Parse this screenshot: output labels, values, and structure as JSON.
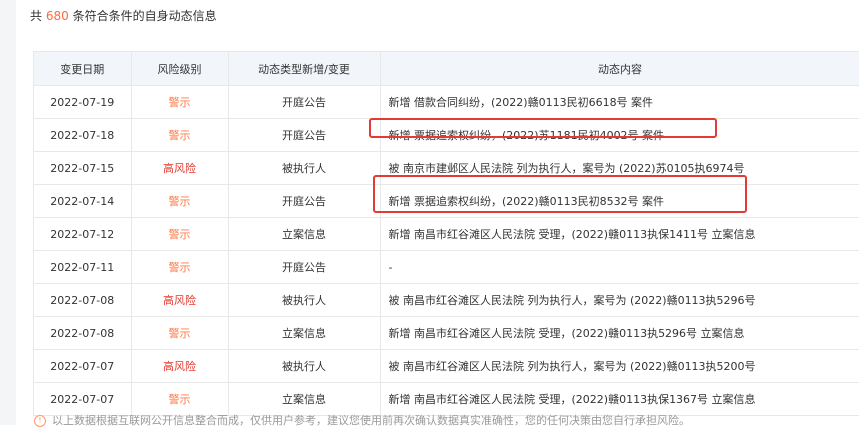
{
  "summary": {
    "prefix": "共",
    "count": "680",
    "suffix": "条符合条件的自身动态信息"
  },
  "table": {
    "headers": [
      "变更日期",
      "风险级别",
      "动态类型新增/变更",
      "动态内容"
    ],
    "rows": [
      {
        "date": "2022-07-19",
        "risk": "警示",
        "risk_type": "warn",
        "type": "开庭公告",
        "content": "新增 借款合同纠纷，(2022)赣0113民初6618号 案件"
      },
      {
        "date": "2022-07-18",
        "risk": "警示",
        "risk_type": "warn",
        "type": "开庭公告",
        "content": "新增 票据追索权纠纷，(2022)苏1181民初4002号 案件"
      },
      {
        "date": "2022-07-15",
        "risk": "高风险",
        "risk_type": "high",
        "type": "被执行人",
        "content": "被 南京市建邺区人民法院 列为执行人，案号为 (2022)苏0105执6974号"
      },
      {
        "date": "2022-07-14",
        "risk": "警示",
        "risk_type": "warn",
        "type": "开庭公告",
        "content": "新增 票据追索权纠纷，(2022)赣0113民初8532号 案件"
      },
      {
        "date": "2022-07-12",
        "risk": "警示",
        "risk_type": "warn",
        "type": "立案信息",
        "content": "新增 南昌市红谷滩区人民法院 受理，(2022)赣0113执保1411号 立案信息"
      },
      {
        "date": "2022-07-11",
        "risk": "警示",
        "risk_type": "warn",
        "type": "开庭公告",
        "content": "-"
      },
      {
        "date": "2022-07-08",
        "risk": "高风险",
        "risk_type": "high",
        "type": "被执行人",
        "content": "被 南昌市红谷滩区人民法院 列为执行人，案号为 (2022)赣0113执5296号"
      },
      {
        "date": "2022-07-08",
        "risk": "警示",
        "risk_type": "warn",
        "type": "立案信息",
        "content": "新增 南昌市红谷滩区人民法院 受理，(2022)赣0113执5296号 立案信息"
      },
      {
        "date": "2022-07-07",
        "risk": "高风险",
        "risk_type": "high",
        "type": "被执行人",
        "content": "被 南昌市红谷滩区人民法院 列为执行人，案号为 (2022)赣0113执5200号"
      },
      {
        "date": "2022-07-07",
        "risk": "警示",
        "risk_type": "warn",
        "type": "立案信息",
        "content": "新增 南昌市红谷滩区人民法院 受理，(2022)赣0113执保1367号 立案信息"
      }
    ]
  },
  "footer": {
    "icon": "info-circle-icon",
    "text": "以上数据根据互联网公开信息整合而成，仅供用户参考，建议您使用前再次确认数据真实准确性，您的任何决策由您自行承担风险。"
  },
  "colors": {
    "warn": "#ff7a45",
    "high": "#e8362b",
    "header_bg": "#f2f6fb",
    "highlight": "#e53935"
  }
}
